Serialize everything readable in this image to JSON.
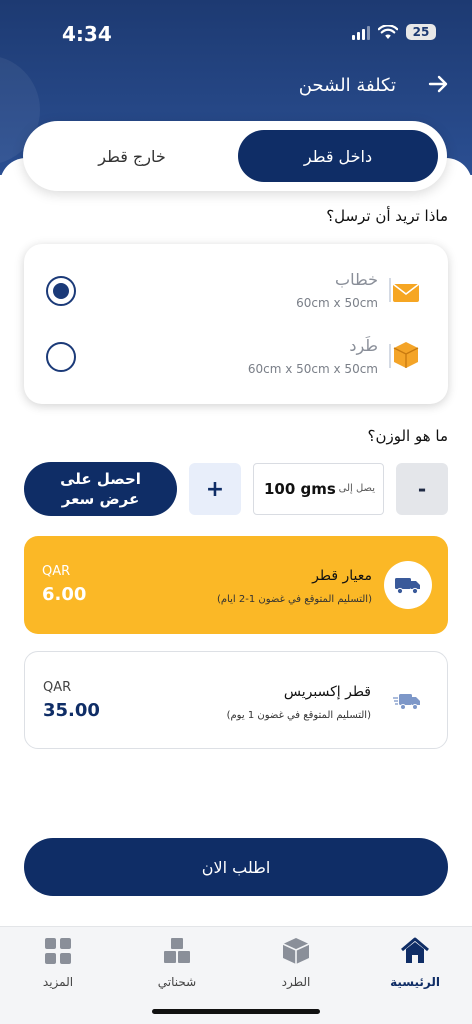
{
  "status_bar": {
    "time": "4:34",
    "battery": "25"
  },
  "header": {
    "title": "تكلفة الشحن"
  },
  "destination_toggle": {
    "options": [
      "داخل قطر",
      "خارج قطر"
    ],
    "selected": "داخل قطر"
  },
  "shipment_type": {
    "question": "ماذا تريد أن ترسل؟",
    "options": [
      {
        "name": "خطاب",
        "dims": "60cm x 50cm",
        "icon": "envelope-icon",
        "selected": true
      },
      {
        "name": "طَرد",
        "dims": "60cm x 50cm x 50cm",
        "icon": "box-icon",
        "selected": false
      }
    ]
  },
  "weight": {
    "question": "ما هو الوزن؟",
    "minus": "-",
    "plus": "+",
    "value": "100 gms",
    "up_to": "يصل إلى",
    "quote_line1": "احصل على",
    "quote_line2": "عرض سعر"
  },
  "services": [
    {
      "name": "معيار قطر",
      "desc": "(التسليم المتوقع في غضون 1-2 ايام)",
      "currency": "QAR",
      "price": "6.00",
      "icon": "truck-icon",
      "selected": true,
      "color": "#fbb826"
    },
    {
      "name": "قطر إكسبريس",
      "desc": "(التسليم المتوقع في غضون 1 يوم)",
      "currency": "QAR",
      "price": "35.00",
      "icon": "express-truck-icon",
      "selected": false
    }
  ],
  "order_button": "اطلب الان",
  "tabbar": [
    {
      "label": "الرئيسية",
      "icon": "home-icon",
      "active": true
    },
    {
      "label": "الطرد",
      "icon": "parcel-icon",
      "active": false
    },
    {
      "label": "شحناتي",
      "icon": "boxes-icon",
      "active": false
    },
    {
      "label": "المزيد",
      "icon": "grid-icon",
      "active": false
    }
  ],
  "colors": {
    "primary": "#0f2d66",
    "header": "#1d3a72",
    "accent": "#fbb826"
  }
}
